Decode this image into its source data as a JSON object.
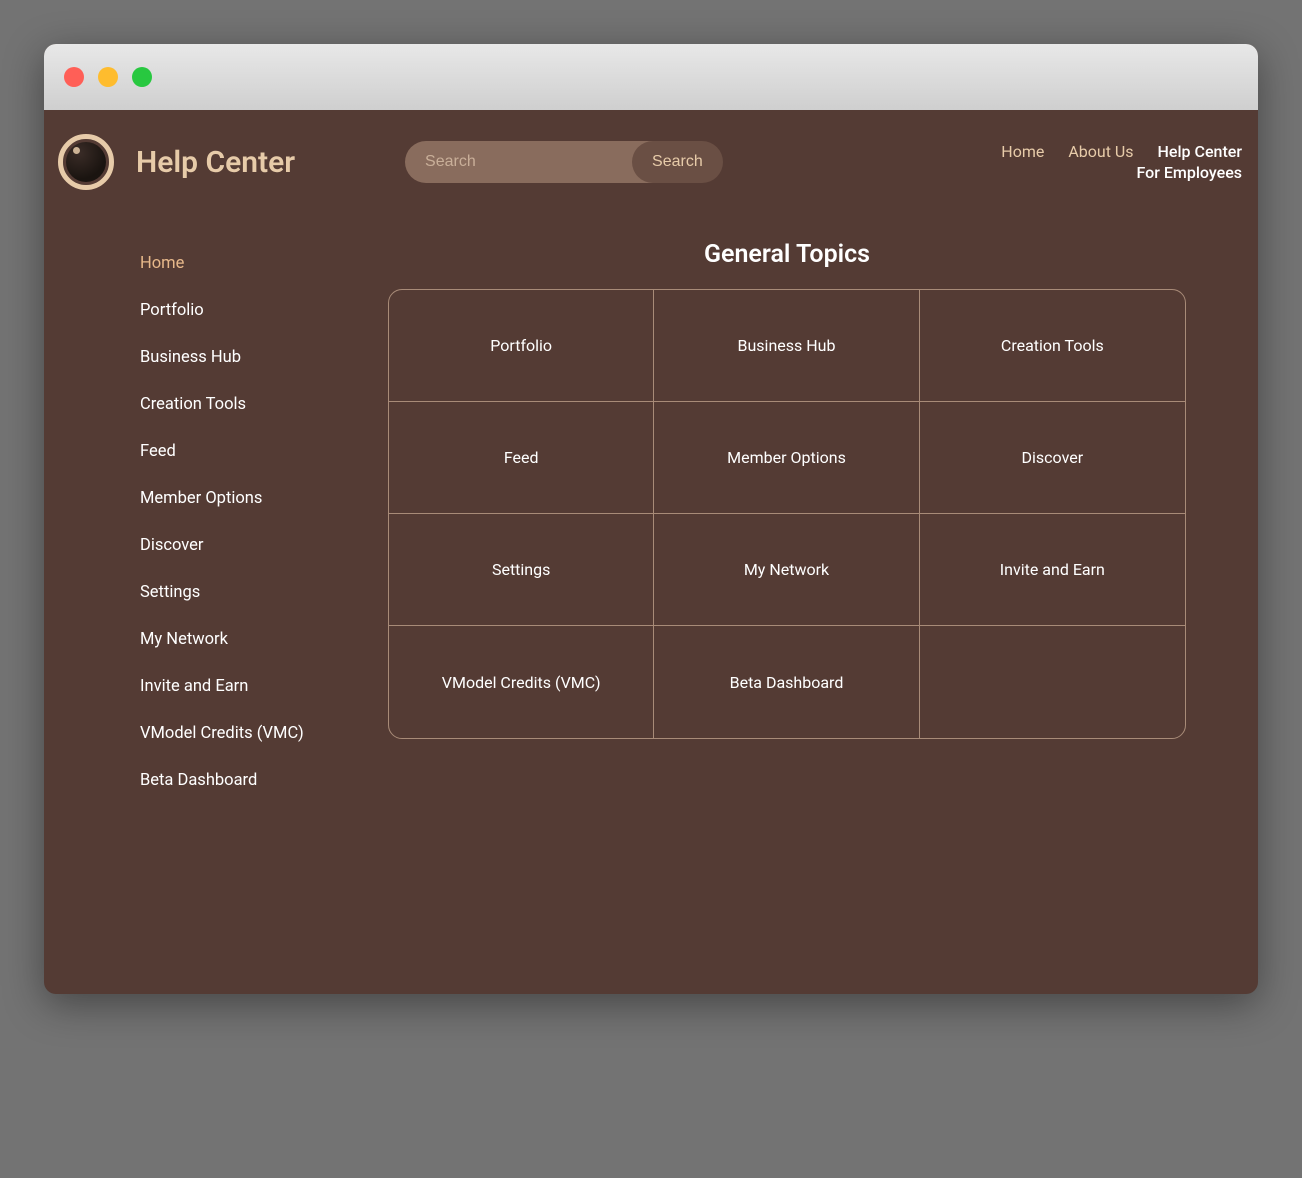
{
  "header": {
    "brand_title": "Help Center"
  },
  "search": {
    "placeholder": "Search",
    "button_label": "Search",
    "value": ""
  },
  "topnav": {
    "links": [
      {
        "label": "Home",
        "active": false
      },
      {
        "label": "About Us",
        "active": false
      },
      {
        "label": "Help Center",
        "active": true
      }
    ],
    "secondary_link": {
      "label": "For Employees",
      "active": true
    }
  },
  "sidebar": {
    "items": [
      {
        "label": "Home",
        "active": true
      },
      {
        "label": "Portfolio",
        "active": false
      },
      {
        "label": "Business Hub",
        "active": false
      },
      {
        "label": "Creation Tools",
        "active": false
      },
      {
        "label": "Feed",
        "active": false
      },
      {
        "label": "Member Options",
        "active": false
      },
      {
        "label": "Discover",
        "active": false
      },
      {
        "label": "Settings",
        "active": false
      },
      {
        "label": "My Network",
        "active": false
      },
      {
        "label": "Invite and Earn",
        "active": false
      },
      {
        "label": "VModel Credits (VMC)",
        "active": false
      },
      {
        "label": "Beta Dashboard",
        "active": false
      }
    ]
  },
  "main": {
    "title": "General Topics",
    "tiles": [
      "Portfolio",
      "Business Hub",
      "Creation Tools",
      "Feed",
      "Member Options",
      "Discover",
      "Settings",
      "My Network",
      "Invite and Earn",
      "VModel Credits (VMC)",
      "Beta Dashboard",
      ""
    ]
  },
  "colors": {
    "bg": "#543B34",
    "accent": "#e7cba9"
  }
}
